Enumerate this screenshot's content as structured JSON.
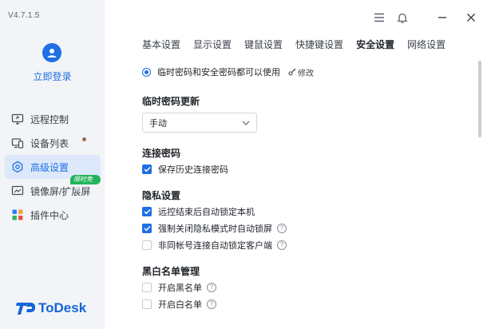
{
  "app": {
    "version": "V4.7.1.5",
    "login_label": "立即登录",
    "logo_text": "ToDesk"
  },
  "sidebar": {
    "items": [
      {
        "label": "远程控制",
        "icon": "monitor-icon"
      },
      {
        "label": "设备列表",
        "icon": "devices-icon"
      },
      {
        "label": "高级设置",
        "icon": "settings-icon"
      },
      {
        "label": "镜像屏/扩展屏",
        "icon": "mirror-screen-icon"
      },
      {
        "label": "插件中心",
        "icon": "plugin-icon"
      }
    ],
    "badge": "限时免费"
  },
  "tabs": [
    {
      "label": "基本设置"
    },
    {
      "label": "显示设置"
    },
    {
      "label": "键鼠设置"
    },
    {
      "label": "快捷键设置"
    },
    {
      "label": "安全设置"
    },
    {
      "label": "网络设置"
    }
  ],
  "security": {
    "password_mode": "临时密码和安全密码都可以使用",
    "modify_label": "修改",
    "temp_update_title": "临时密码更新",
    "temp_update_value": "手动",
    "connect_title": "连接密码",
    "save_history": "保存历史连接密码",
    "privacy_title": "隐私设置",
    "privacy": [
      {
        "label": "远控结束后自动锁定本机",
        "checked": true
      },
      {
        "label": "强制关闭隐私模式时自动锁屏",
        "checked": true
      },
      {
        "label": "非同帐号连接自动锁定客户端",
        "checked": false
      }
    ],
    "blacklist_title": "黑白名单管理",
    "lists": [
      {
        "label": "开启黑名单",
        "checked": false
      },
      {
        "label": "开启白名单",
        "checked": false
      }
    ],
    "help_glyph": "?"
  },
  "colors": {
    "accent": "#1f6fe5",
    "sidebar_bg": "#f2f4f7",
    "active_bg": "#dde9fb",
    "badge": "#23b35c"
  }
}
